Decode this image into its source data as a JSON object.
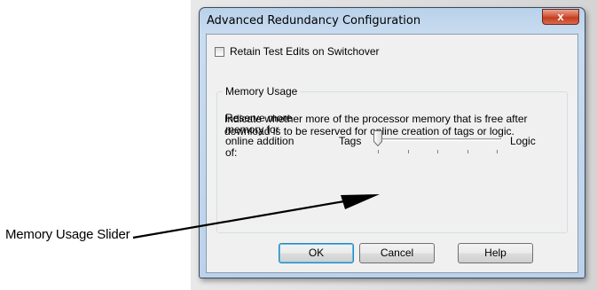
{
  "callout": {
    "text": "Memory Usage Slider"
  },
  "dialog": {
    "title": "Advanced Redundancy Configuration",
    "close_glyph": "x",
    "retain_checkbox": {
      "label": "Retain Test Edits on Switchover",
      "checked": false
    },
    "memory_group": {
      "legend": "Memory Usage",
      "description": "Indicate whether more of the processor memory that is free after download is to be reserved for online creation of tags or logic.",
      "slider_label": "Reserve more memory for online addition of:",
      "left_label": "Tags",
      "right_label": "Logic",
      "slider_value": 0,
      "slider_ticks": 5
    },
    "buttons": {
      "ok": "OK",
      "cancel": "Cancel",
      "help": "Help"
    }
  }
}
